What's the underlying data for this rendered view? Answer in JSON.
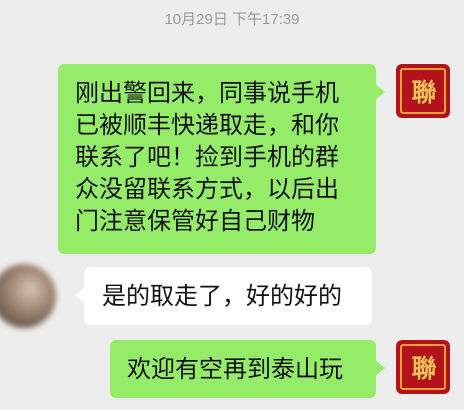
{
  "timestamp": "10月29日 下午17:39",
  "messages": [
    {
      "side": "right",
      "text": "刚出警回来，同事说手机已被顺丰快递取走，和你联系了吧！捡到手机的群众没留联系方式，以后出门注意保管好自己财物",
      "avatar": "police-seal-avatar"
    },
    {
      "side": "left",
      "text": "是的取走了，好的好的",
      "avatar": "blurred-avatar"
    },
    {
      "side": "right",
      "text": "欢迎有空再到泰山玩",
      "avatar": "police-seal-avatar"
    }
  ],
  "seal_glyph": "聯",
  "colors": {
    "background": "#ededed",
    "sent_bubble": "#95ec69",
    "received_bubble": "#ffffff",
    "seal_red": "#b3121a",
    "seal_gold": "#f2c15a"
  }
}
